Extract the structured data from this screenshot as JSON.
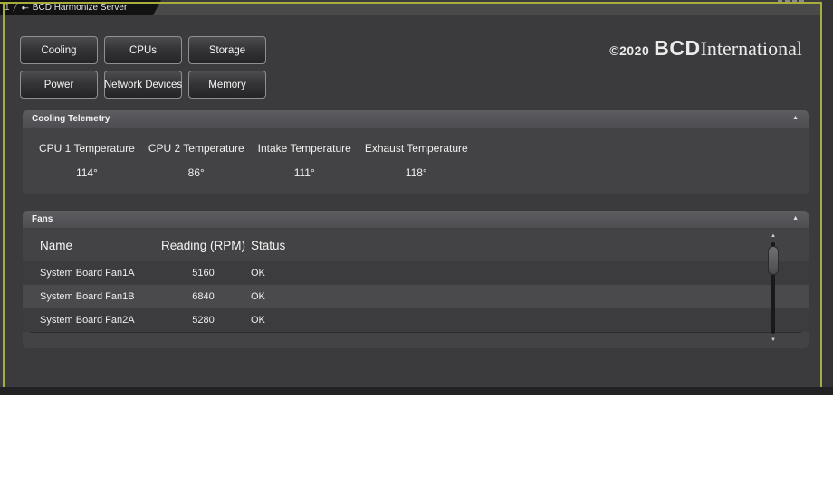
{
  "titlebar": {
    "tab_index": "1",
    "separator": "/",
    "tab_icon_glyph": "●--",
    "title": "BCD Harmonize Server"
  },
  "logo": {
    "copyright": "©2020",
    "brand": "BCD",
    "brand_suffix": "International"
  },
  "nav_buttons": [
    "Cooling",
    "CPUs",
    "Storage",
    "Power",
    "Network Devices",
    "Memory"
  ],
  "cooling_panel": {
    "title": "Cooling Telemetry",
    "collapse_icon": "▲",
    "metrics": [
      {
        "label": "CPU 1 Temperature",
        "value": "114°"
      },
      {
        "label": "CPU 2 Temperature",
        "value": "86°"
      },
      {
        "label": "Intake Temperature",
        "value": "111°"
      },
      {
        "label": "Exhaust Temperature",
        "value": "118°"
      }
    ]
  },
  "fans_panel": {
    "title": "Fans",
    "collapse_icon": "▲",
    "columns": [
      "Name",
      "Reading (RPM)",
      "Status"
    ],
    "rows": [
      {
        "name": "System Board Fan1A",
        "reading": "5160",
        "status": "OK"
      },
      {
        "name": "System Board Fan1B",
        "reading": "6840",
        "status": "OK"
      },
      {
        "name": "System Board Fan2A",
        "reading": "5280",
        "status": "OK"
      }
    ],
    "scrollbar": {
      "up_icon": "▲",
      "down_icon": "▼"
    }
  },
  "colors": {
    "accent_border": "#a8ae3c",
    "window_bg": "#3b3b3d",
    "panel_body": "#434345",
    "panel_header": "#55555a"
  }
}
